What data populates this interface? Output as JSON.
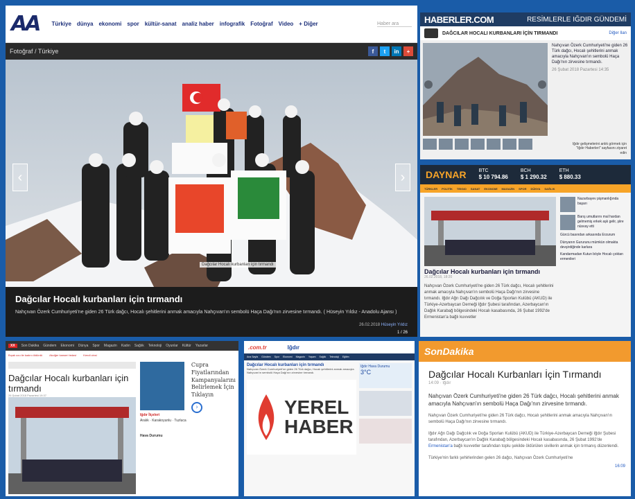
{
  "p1": {
    "logo": "AA",
    "nav": [
      "Türkiye",
      "dünya",
      "ekonomi",
      "spor",
      "kültür-sanat",
      "analiz haber",
      "infografik",
      "Fotoğraf",
      "Video",
      "+ Diğer"
    ],
    "search": "Haber ara",
    "crumb": "Fotoğraf / Türkiye",
    "social": [
      "f",
      "t",
      "in",
      "+"
    ],
    "photo_caption": "Dağcılar Hocalı kurbanları için tırmandı",
    "title": "Dağcılar Hocalı kurbanları için tırmandı",
    "desc": "Nahçıvan Özerk Cumhuriyeti'ne giden 26 Türk dağcı, Hocalı şehitlerini anmak amacıyla Nahçıvan'ın sembolü Haça Dağı'nın zirvesine tırmandı. ( Hüseyin Yıldız - Anadolu Ajansı )",
    "date": "26.02.2018",
    "author": "Hüseyin Yıldız",
    "count": "1 / 26",
    "prev": "‹",
    "next": "›"
  },
  "p2": {
    "logo": "HABERLER.COM",
    "right": "RESİMLERLE IĞDIR GÜNDEMİ",
    "subtitle": "DAĞCILAR HOCALI KURBANLARI İÇİN TIRMANDI",
    "link": "Diğer Ilan",
    "side_text": "Nahçıvan Özerk Cumhuriyeti'ne giden 26 Türk dağcı, Hocalı şehitlerini anmak amacıyla Nahçıvan'ın sembolü Haça Dağı'nın zirvesine tırmandı.",
    "side_date": "26 Şubat 2018 Pazartesi 14:35",
    "note": "Iğdır gelişmelerini anlık görmek için \"Iğdır Haberleri\" sayfasını ziyaret edin"
  },
  "p3": {
    "logo": "DAYNAR",
    "ticker": [
      {
        "name": "BTC",
        "value": "$ 10 794.86"
      },
      {
        "name": "BCH",
        "value": "$ 1 290.32"
      },
      {
        "name": "ETH",
        "value": "$ 880.33"
      }
    ],
    "nav": [
      "TÜRKLER",
      "POLİTİK",
      "TEKNO",
      "SANAT",
      "EKONOMİ",
      "MAGAZİN",
      "SPOR",
      "DÜNYA",
      "SAĞLIK"
    ],
    "title": "Dağcılar Hocalı kurbanları için tırmandı",
    "date": "26.02.2018, 18:20",
    "text": "Nahçıvan Özerk Cumhuriyeti'ne giden 26 Türk dağcı, Hocalı şehitlerini anmak amacıyla Nahçıvan'ın sembolü Haça Dağı'nın zirvesine tırmandı. Iğdır Ağrı Dağı Dağcılık ve Doğa Sporları Kulübü (AKUD) ile Türkiye-Azerbaycan Derneği Iğdır Şubesi tarafından, Azerbaycan'ın Dağlık Karabağ bölgesindeki Hocalı kasabasında, 26 Şubat 1992'de Ermenistan'a bağlı kuvvetler",
    "side": [
      "Nazarbayev pişmanlığında başarı",
      "Barış umutlarını mal hardan gelmemiş erkek aşk gelir, şiire nüsvay etti",
      "Gürcü basından arkasında Erzurum",
      "Dünyanın Gururunu mümkün olmakta devşirdiğinde karlara",
      "Kandarmadan Kutun böyle Hocalı çoktan ermenileri"
    ]
  },
  "p4": {
    "logo": "XX",
    "nav": [
      "Son Dakika",
      "Gündem",
      "Ekonomi",
      "Dünya",
      "Spor",
      "Magazin",
      "Kadın",
      "Sağlık",
      "Teknoloji",
      "Oyunlar",
      "Kültür",
      "Yazarlar"
    ],
    "sub": [
      "Bıçak ucu ile kadını öldürdü ",
      "Akciğer kanseri tedavi",
      "Kendi cinsi"
    ],
    "title": "Dağcılar Hocalı kurbanları için tırmandı",
    "date": "26 Şubat 2018 Pazartesi 19:37",
    "mid_title": "Iğdır İlçeleri",
    "mid_items": "Aralık · Karakoyunlu · Tuzluca",
    "mid_more": "Hava Durumu",
    "right_text": "Cupra Fiyatlarından Kampanyalarını Belirlemek İçin Tıklayın",
    "more": "›"
  },
  "p5": {
    "logo": ".com.tr",
    "city": "Iğdır",
    "nav": [
      "Ana Sayfa",
      "Gündem",
      "Spor",
      "Ekonomi",
      "Magazin",
      "Yaşam",
      "Sağlık",
      "Teknoloji",
      "Eğitim"
    ],
    "t1": "Dağcılar Hocalı kurbanları için tırmandı",
    "txt": "Nahçıvan Özerk Cumhuriyeti'ne giden 26 Türk dağcı, Hocalı şehitlerini anmak amacıyla Nahçıvan'ın sembolü Haça Dağı'nın zirvesine tırmandı.",
    "yerel": "YEREL",
    "haber": "HABER",
    "weather_title": "Iğdır Hava Durumu",
    "weather_temp": "3°C"
  },
  "p6": {
    "logo": "SonDakika",
    "title": "Dağcılar Hocalı Kurbanları İçin Tırmandı",
    "date": "14:09 · Iğdır",
    "lead": "Nahçıvan Özerk Cumhuriyeti'ne giden 26 Türk dağcı, Hocalı şehitlerini anmak amacıyla Nahçıvan'ın sembolü Haça Dağı'nın zirvesine tırmandı.",
    "p1": "Nahçıvan Özerk Cumhuriyeti'ne giden 26 Türk dağcı, Hocalı şehitlerini anmak amacıyla Nahçıvan'ın sembolü Haça Dağı'nın zirvesine tırmandı.",
    "p2_pre": "Iğdır Ağrı Dağı Dağcılık ve Doğa Sporları Kulübü (AKUD) ile Türkiye-Azerbaycan Derneği Iğdır Şubesi tarafından, Azerbaycan'ın Dağlık Karabağ bölgesindeki Hocalı kasabasında, 26 Şubat 1992'de ",
    "p2_link": "Ermenistan'a",
    "p2_post": " bağlı kuvvetler tarafından toplu şekilde öldürülen sivillerin anmak için tırmanış düzenlendi.",
    "p3": "Türkiye'nin farklı şehirlerinden gelen 26 dağcı, Nahçıvan Özerk Cumhuriyeti'ne",
    "time": "16:09"
  }
}
